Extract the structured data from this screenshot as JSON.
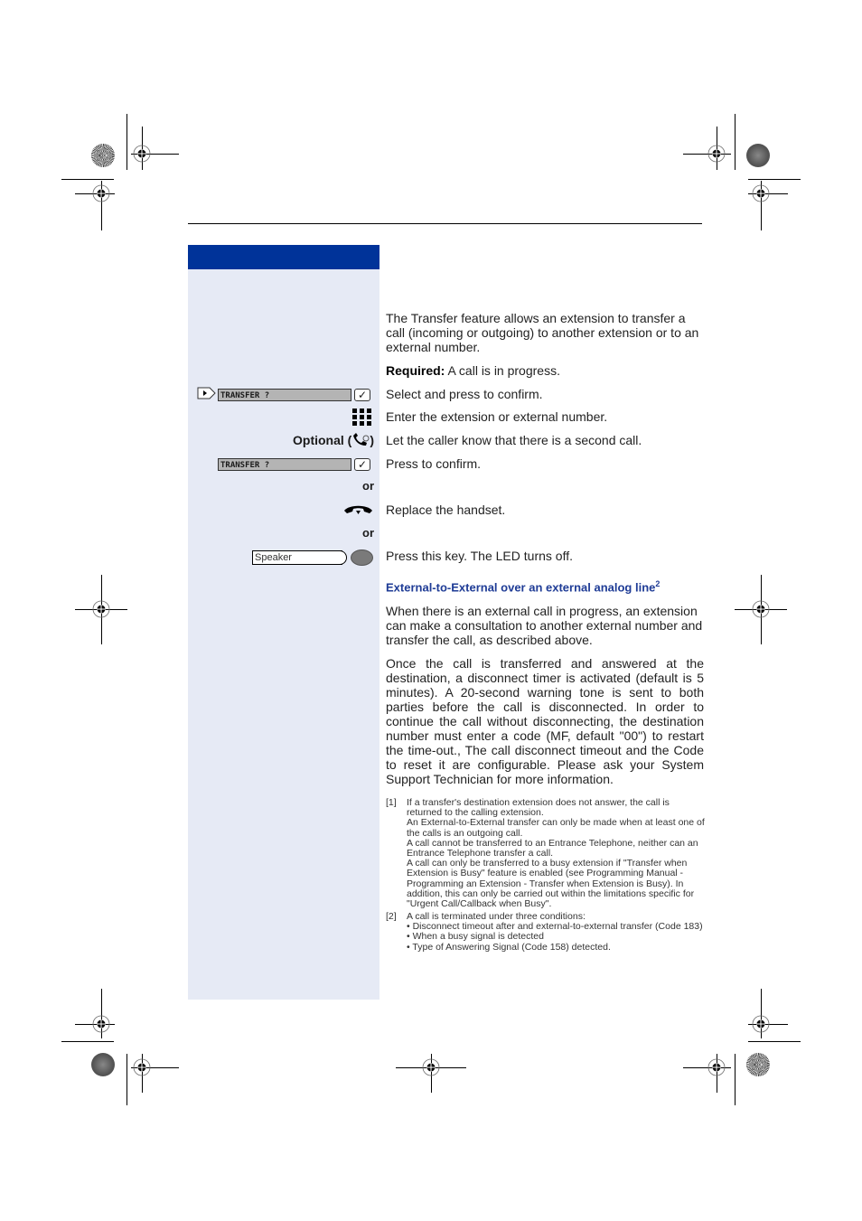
{
  "page": {
    "intro": "The Transfer feature allows an extension to transfer a call (incoming or outgoing) to another extension or to an external number.",
    "required_label": "Required:",
    "required_text": "A call is in progress."
  },
  "steps": [
    {
      "display": "TRANSFER ?",
      "check": "✓",
      "text": "Select and press to confirm."
    },
    {
      "icon": "keypad-icon",
      "text": "Enter the extension or external number."
    },
    {
      "label": "Optional (",
      "label_end": ")",
      "text": "Let the caller know that there is a second call."
    },
    {
      "display": "TRANSFER ?",
      "check": "✓",
      "text": "Press to confirm."
    },
    {
      "or": "or"
    },
    {
      "icon": "handset-down-icon",
      "text": "Replace the handset."
    },
    {
      "or": "or"
    },
    {
      "key": "Speaker",
      "text": "Press this key. The LED turns off."
    }
  ],
  "section": {
    "heading": "External-to-External over an external analog line",
    "heading_sup": "2",
    "para1": "When there is an external call in progress, an extension can make a consultation to another external number and transfer the call, as described above.",
    "para2": "Once the call is transferred and answered at the destination, a disconnect timer is activated (default is 5 minutes). A 20-second warning tone is sent to both parties before the call is disconnected. In order to continue the call without disconnecting, the destination number must enter a code (MF, default \"00\") to restart the time-out., The call disconnect timeout and the Code to reset it are configurable. Please ask your System Support Technician for more information."
  },
  "footnotes": [
    {
      "num": "[1]",
      "lines": [
        "If a transfer's destination extension does not answer, the call is returned to the calling extension.",
        "An External-to-External transfer can only be made when at least one of the calls is an outgoing call.",
        "A call cannot be transferred to an Entrance Telephone, neither can an Entrance Telephone transfer a call.",
        "A call can only be transferred to a busy extension if \"Transfer when Extension is Busy\" feature is enabled (see Programming Manual - Programming an Extension - Transfer when Extension is Busy). In addition, this can only be carried out within the limitations specific for \"Urgent Call/Callback when Busy\"."
      ]
    },
    {
      "num": "[2]",
      "lines": [
        "A call is terminated under three conditions:",
        "• Disconnect timeout after and external-to-external transfer (Code 183)",
        "• When a busy signal is detected",
        "• Type of Answering Signal (Code 158) detected."
      ]
    }
  ],
  "colors": {
    "accent": "#003399",
    "sidebar_bg": "#e6eaf5",
    "heading": "#1f3c96"
  }
}
